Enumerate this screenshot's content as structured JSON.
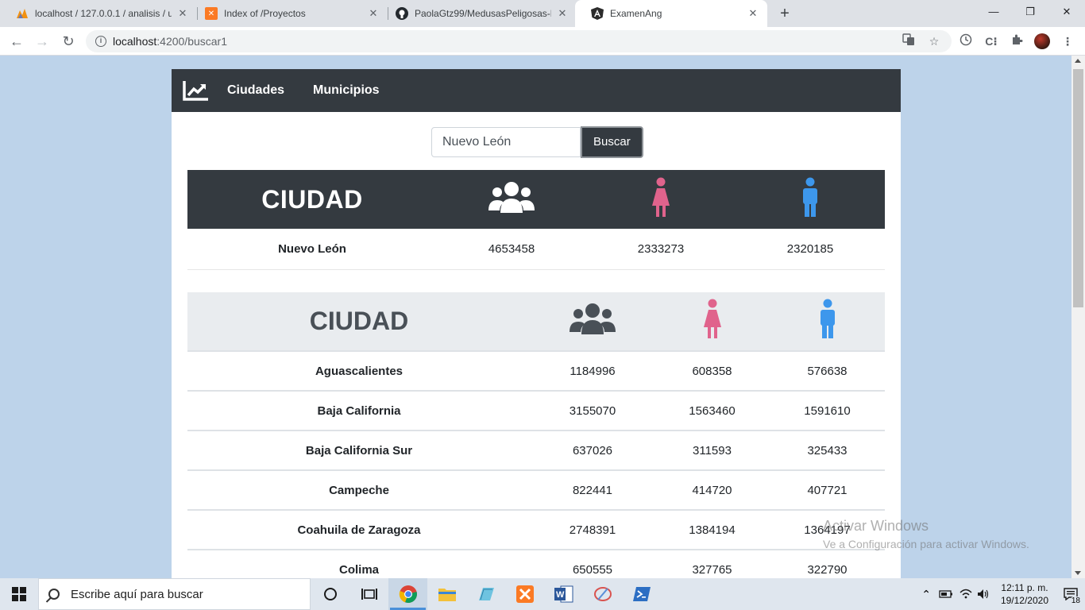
{
  "browser": {
    "tabs": [
      {
        "title": "localhost / 127.0.0.1 / analisis / u",
        "icon": "phpmyadmin-icon"
      },
      {
        "title": "Index of /Proyectos",
        "icon": "xampp-icon"
      },
      {
        "title": "PaolaGtz99/MedusasPeligosas-P",
        "icon": "github-icon"
      },
      {
        "title": "ExamenAng",
        "icon": "angular-icon"
      }
    ],
    "url_host": "localhost",
    "url_path": ":4200/buscar1"
  },
  "app": {
    "nav": {
      "link1": "Ciudades",
      "link2": "Municipios"
    },
    "search": {
      "value": "Nuevo León",
      "button": "Buscar"
    },
    "result": {
      "header": "CIUDAD",
      "row": {
        "name": "Nuevo León",
        "total": "4653458",
        "women": "2333273",
        "men": "2320185"
      }
    },
    "list": {
      "header": "CIUDAD",
      "rows": [
        {
          "name": "Aguascalientes",
          "total": "1184996",
          "women": "608358",
          "men": "576638"
        },
        {
          "name": "Baja California",
          "total": "3155070",
          "women": "1563460",
          "men": "1591610"
        },
        {
          "name": "Baja California Sur",
          "total": "637026",
          "women": "311593",
          "men": "325433"
        },
        {
          "name": "Campeche",
          "total": "822441",
          "women": "414720",
          "men": "407721"
        },
        {
          "name": "Coahuila de Zaragoza",
          "total": "2748391",
          "women": "1384194",
          "men": "1364197"
        },
        {
          "name": "Colima",
          "total": "650555",
          "women": "327765",
          "men": "322790"
        }
      ]
    },
    "colors": {
      "female": "#e0638c",
      "male": "#3d97ec",
      "dark": "#343a40"
    }
  },
  "watermark": {
    "line1": "Activar Windows",
    "line2": "Ve a Configuración para activar Windows."
  },
  "taskbar": {
    "search_placeholder": "Escribe aquí para buscar",
    "time": "12:11 p. m.",
    "date": "19/12/2020",
    "notifications": "18"
  }
}
